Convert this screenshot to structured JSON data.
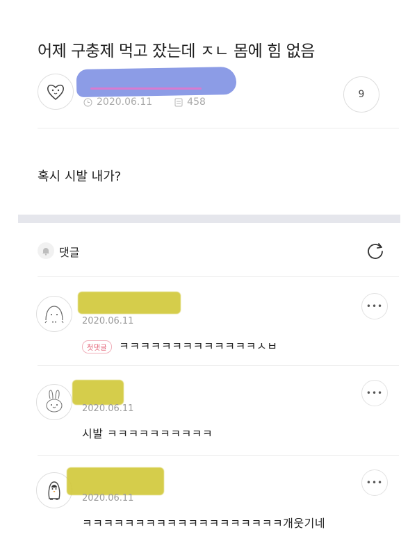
{
  "post": {
    "title": "어제 구충제 먹고 잤는데 ㅈㄴ 몸에 힘 없음",
    "date": "2020.06.11",
    "views": "458",
    "comment_count": "9",
    "body": "혹시 시발 내가?"
  },
  "comments_section": {
    "header_label": "댓글"
  },
  "comments": [
    {
      "date": "2020.06.11",
      "badge": "첫댓글",
      "text": "ㅋㅋㅋㅋㅋㅋㅋㅋㅋㅋㅋㅋㅋㅅㅂ"
    },
    {
      "date": "2020.06.11",
      "text": "시발 ㅋㅋㅋㅋㅋㅋㅋㅋㅋㅋ"
    },
    {
      "date": "2020.06.11",
      "text": "ㅋㅋㅋㅋㅋㅋㅋㅋㅋㅋㅋㅋㅋㅋㅋㅋㅋㅋㅋ개웃기네"
    }
  ],
  "icons": {
    "author_avatar": "heart-face-icon",
    "bell": "bell-icon",
    "refresh": "refresh-icon",
    "more": "more-dots-icon"
  },
  "colors": {
    "redaction_blue": "#8c9ce6",
    "redaction_yellow": "#d2c93c",
    "band": "#e5e6ec"
  }
}
